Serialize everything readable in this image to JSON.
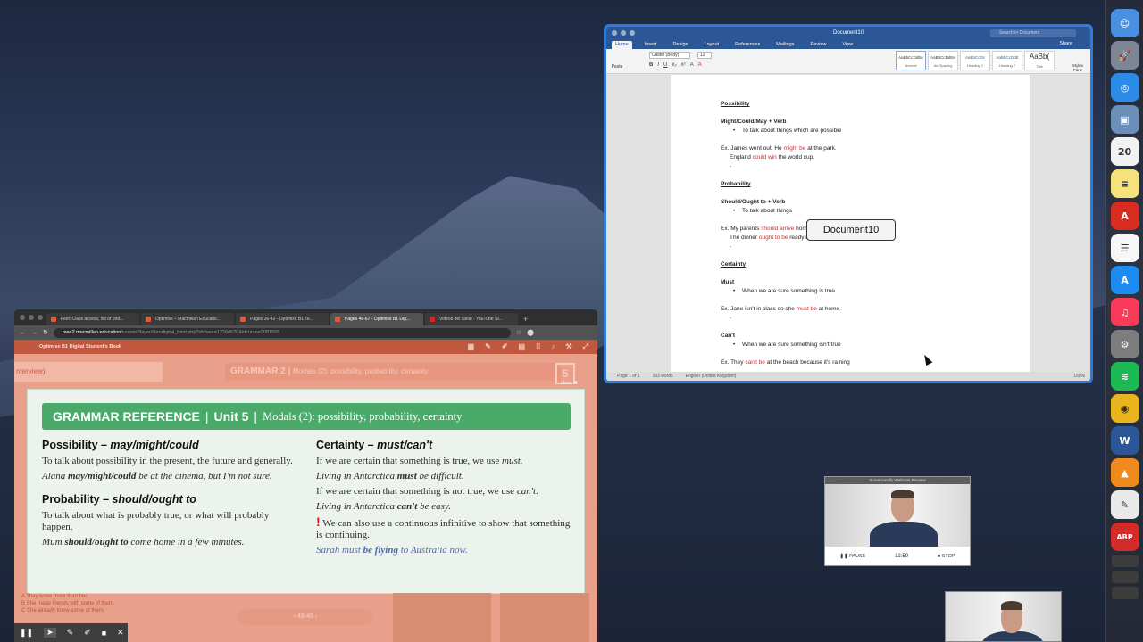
{
  "word": {
    "window_title": "Document10",
    "search_placeholder": "Search in Document",
    "tabs": [
      "Home",
      "Insert",
      "Design",
      "Layout",
      "References",
      "Mailings",
      "Review",
      "View"
    ],
    "share": "Share",
    "paste": "Paste",
    "font": "Calibri (Body)",
    "size": "12",
    "format_buttons": [
      "B",
      "I",
      "U",
      "x₂",
      "x²",
      "A",
      "A"
    ],
    "styles": [
      {
        "sample": "AaBbCcDdEe",
        "name": "Normal"
      },
      {
        "sample": "AaBbCcDdEe",
        "name": "No Spacing"
      },
      {
        "sample": "AaBbCcDc",
        "name": "Heading 1"
      },
      {
        "sample": "AaBbCcDdE",
        "name": "Heading 2"
      },
      {
        "sample": "AaBb(",
        "name": "Title"
      }
    ],
    "styles_pane": "Styles Pane",
    "tooltip": "Document10",
    "doc": {
      "possibility": "Possibility",
      "might_heading": "Might/Could/May + Verb",
      "might_bullet": "To talk about things which are possible",
      "ex1_pre": "Ex. James went out. He ",
      "ex1_red": "might be",
      "ex1_post": " at the park.",
      "ex2_pre": "England ",
      "ex2_red": "could win",
      "ex2_post": " the world cup.",
      "dash": "-",
      "probability": "Probability",
      "should_heading": "Should/Ought to + Verb",
      "should_bullet": "To talk about things",
      "ex3_pre": "Ex. My parents ",
      "ex3_red": "should arrive",
      "ex3_post": " home at 5:00",
      "ex4_pre": "The dinner ",
      "ex4_red": "ought to be",
      "ex4_post": " ready in 10 minutes",
      "certainty": "Certainty",
      "must_heading": "Must",
      "must_bullet": "When we are sure something is true",
      "ex5_pre": "Ex. Jane isn't in class so she ",
      "ex5_red": "must be",
      "ex5_post": " at home.",
      "cant_heading": "Can't",
      "cant_bullet": "When we are sure something isn't true",
      "ex6_pre": "Ex. They ",
      "ex6_red": "can't be",
      "ex6_post": " at the beach because it's raining"
    },
    "status": {
      "page": "Page 1 of 1",
      "words": "103 words",
      "language": "English (United Kingdom)",
      "zoom": "150%"
    }
  },
  "browser": {
    "tabs": [
      {
        "title": "Feel: Class access, list of brid...",
        "active": false
      },
      {
        "title": "Optimise – Macmillan Educatio...",
        "active": false
      },
      {
        "title": "Pages 36-42 - Optimise B1 Te...",
        "active": false
      },
      {
        "title": "Pages 48-67 - Optimise B1 Dig...",
        "active": true
      },
      {
        "title": "Videos del canal - YouTube St...",
        "active": false
      }
    ],
    "url_host": "mee2.macmillan.education",
    "url_path": "/coursePlayer/librodigital_html.php?idclase=12204620&idcurso=2081506",
    "app_title": "Optimise B1 Digital Student's Book",
    "bg_left": "nterview)",
    "bg_grammar": "GRAMMAR 2",
    "bg_grammar_sub": "Modals (2): possibility, probability, certainty",
    "bg_num": "5",
    "close": "close",
    "grammar": {
      "b1": "GRAMMAR REFERENCE",
      "b2": "Unit 5",
      "b3": "Modals (2): possibility, probability, certainty",
      "poss_title": "Possibility – ",
      "poss_title_it": "may/might/could",
      "poss_text": "To talk about possibility in the present, the future and generally.",
      "poss_ex_pre": "Alana ",
      "poss_ex_bold": "may/might/could",
      "poss_ex_post": " be at the cinema, but I'm not sure.",
      "prob_title": "Probability – ",
      "prob_title_it": "should/ought to",
      "prob_text": "To talk about what is probably true, or what will probably happen.",
      "prob_ex_pre": "Mum ",
      "prob_ex_bold": "should/ought to",
      "prob_ex_post": " come home in a few minutes.",
      "cert_title": "Certainty – ",
      "cert_title_it": "must/can't",
      "cert_text1_pre": "If we are certain that something is true, we use ",
      "cert_text1_it": "must.",
      "cert_ex1_pre": "Living in Antarctica ",
      "cert_ex1_bold": "must",
      "cert_ex1_post": " be difficult.",
      "cert_text2_pre": "If we are certain that something is not true, we use ",
      "cert_text2_it": "can't.",
      "cert_ex2_pre": "Living in Antarctica ",
      "cert_ex2_bold": "can't",
      "cert_ex2_post": " be easy.",
      "note_mark": "!",
      "note_text": " We can also use a continuous infinitive to show that something is continuing.",
      "note_ex_pre": "Sarah must ",
      "note_ex_bold": "be flying",
      "note_ex_post": " to Australia now."
    },
    "faint_lines": [
      "A  They knew more than her.",
      "B  She made friends with some of them.",
      "C  She already knew some of them."
    ],
    "page_nav": "‹   48-49   ›",
    "rec_toolbar": [
      "❚❚",
      "➤",
      "✎",
      "✐",
      "■",
      "✕"
    ]
  },
  "webcam": {
    "title": "Screencastify Webcam Preview",
    "pause": "PAUSE",
    "time": "12:59",
    "stop": "STOP"
  },
  "dock": [
    {
      "name": "finder-icon",
      "color": "#4a8fe0",
      "glyph": "☺"
    },
    {
      "name": "launchpad-icon",
      "color": "#7c8694",
      "glyph": "🚀"
    },
    {
      "name": "safari-icon",
      "color": "#2d8be8",
      "glyph": "◎"
    },
    {
      "name": "preview-icon",
      "color": "#6b8fb8",
      "glyph": "▣"
    },
    {
      "name": "calendar-icon",
      "color": "#f2f2f2",
      "glyph": "20"
    },
    {
      "name": "notes-icon",
      "color": "#f5e27a",
      "glyph": "≡"
    },
    {
      "name": "acrobat-icon",
      "color": "#d62d20",
      "glyph": "A"
    },
    {
      "name": "reminders-icon",
      "color": "#f7f7f7",
      "glyph": "☰"
    },
    {
      "name": "app-store-icon",
      "color": "#1d8cf0",
      "glyph": "A"
    },
    {
      "name": "music-icon",
      "color": "#fa3a5a",
      "glyph": "♫"
    },
    {
      "name": "system-preferences-icon",
      "color": "#7d7d7d",
      "glyph": "⚙"
    },
    {
      "name": "spotify-icon",
      "color": "#1db954",
      "glyph": "≋"
    },
    {
      "name": "chrome-icon",
      "color": "#e8b51e",
      "glyph": "◉"
    },
    {
      "name": "word-icon",
      "color": "#2b5797",
      "glyph": "W"
    },
    {
      "name": "vlc-icon",
      "color": "#f08a1c",
      "glyph": "▲"
    },
    {
      "name": "document-icon",
      "color": "#e9e9e9",
      "glyph": "✎"
    },
    {
      "name": "adblock-icon",
      "color": "#d32a2a",
      "glyph": "ABP"
    }
  ]
}
